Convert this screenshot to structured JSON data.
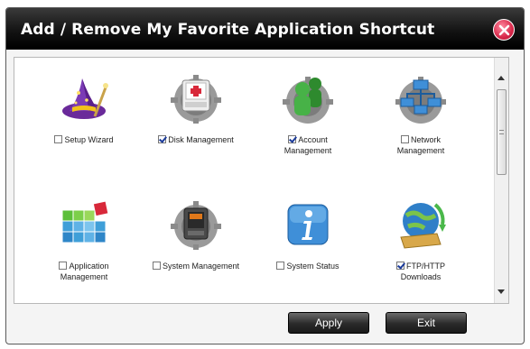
{
  "dialog": {
    "title": "Add / Remove My Favorite Application Shortcut"
  },
  "shortcuts": [
    {
      "label": "Setup Wizard",
      "checked": false,
      "icon": "wizard-hat-icon"
    },
    {
      "label": "Disk Management",
      "checked": true,
      "icon": "disk-management-icon"
    },
    {
      "label": "Account",
      "label2": "Management",
      "checked": true,
      "icon": "account-management-icon"
    },
    {
      "label": "Network",
      "label2": "Management",
      "checked": false,
      "icon": "network-management-icon"
    },
    {
      "label": "Application",
      "label2": "Management",
      "checked": false,
      "icon": "application-management-icon"
    },
    {
      "label": "System Management",
      "checked": false,
      "icon": "system-management-icon"
    },
    {
      "label": "System Status",
      "checked": false,
      "icon": "system-status-icon"
    },
    {
      "label": "FTP/HTTP",
      "label2": "Downloads",
      "checked": true,
      "icon": "ftp-http-downloads-icon"
    }
  ],
  "buttons": {
    "apply": "Apply",
    "exit": "Exit"
  }
}
